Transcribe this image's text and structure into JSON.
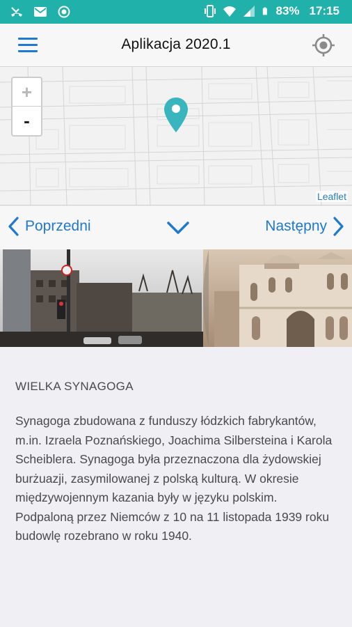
{
  "status_bar": {
    "left_icons": [
      "missed-call-icon",
      "mail-icon",
      "record-icon"
    ],
    "battery": "83%",
    "time": "17:15"
  },
  "header": {
    "title": "Aplikacja 2020.1",
    "menu_icon": "hamburger-menu-icon",
    "locate_icon": "crosshair-locate-icon"
  },
  "map": {
    "zoom_in": "+",
    "zoom_out": "-",
    "attribution": "Leaflet",
    "marker_color": "#39b5bd"
  },
  "nav": {
    "prev_label": "Poprzedni",
    "next_label": "Następny",
    "accent_color": "#1f78d1"
  },
  "article": {
    "heading": "WIELKA SYNAGOGA",
    "body": "Synagoga zbudowana z funduszy łódzkich fabrykantów, m.in. Izraela Poznańskiego, Joachima Silbersteina i Karola Scheiblera. Synagoga była przeznaczona dla żydowskiej burżuazji, zasymilowanej z polską kulturą. W okresie międzywojennym kazania były w języku polskim. Podpaloną przez Niemców z 10 na 11 listopada 1939 roku budowlę rozebrano w roku 1940."
  }
}
